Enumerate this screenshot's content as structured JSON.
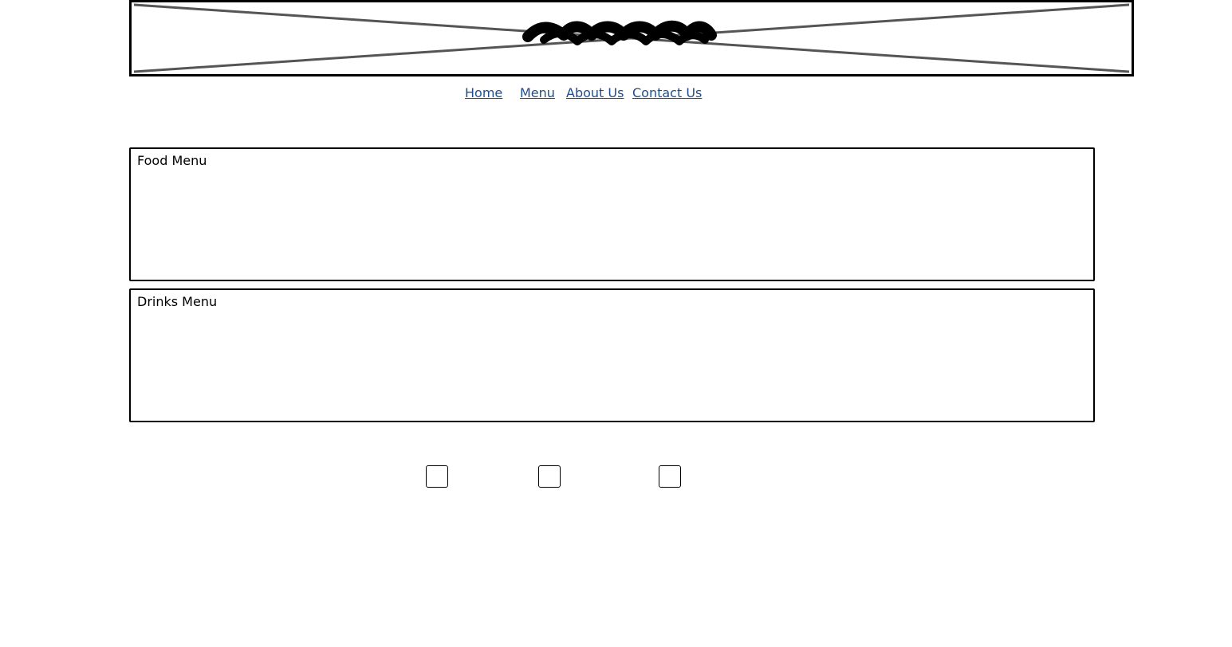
{
  "colors": {
    "link": "#1f4e8c",
    "border": "#000000",
    "placeholder_line": "#555555"
  },
  "header": {
    "image_placeholder_icon": "image-placeholder-icon",
    "logo_icon": "scribble-logo-icon"
  },
  "nav": {
    "items": [
      {
        "label": "Home"
      },
      {
        "label": "Menu"
      },
      {
        "label": "About Us"
      },
      {
        "label": "Contact Us"
      }
    ]
  },
  "main": {
    "food_menu": {
      "title": "Food Menu"
    },
    "drinks_menu": {
      "title": "Drinks Menu"
    }
  },
  "footer": {
    "icons": [
      "social-icon-placeholder",
      "social-icon-placeholder",
      "social-icon-placeholder"
    ]
  }
}
